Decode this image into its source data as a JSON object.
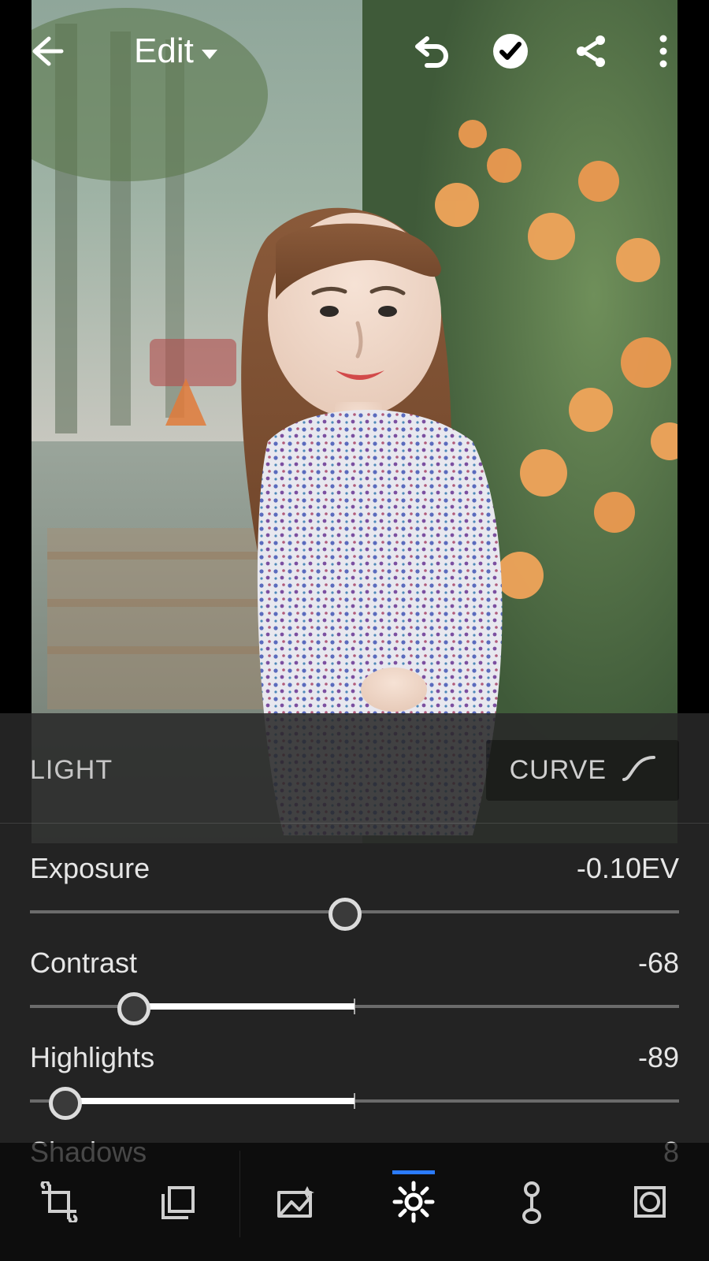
{
  "header": {
    "mode_label": "Edit"
  },
  "panel": {
    "title": "LIGHT",
    "curve_label": "CURVE"
  },
  "sliders": [
    {
      "label": "Exposure",
      "value_text": "-0.10EV",
      "thumb_pct": 48.5,
      "fill_from_pct": 48.5,
      "fill_to_pct": 50
    },
    {
      "label": "Contrast",
      "value_text": "-68",
      "thumb_pct": 16,
      "fill_from_pct": 16,
      "fill_to_pct": 50
    },
    {
      "label": "Highlights",
      "value_text": "-89",
      "thumb_pct": 5.5,
      "fill_from_pct": 5.5,
      "fill_to_pct": 50
    },
    {
      "label": "Shadows",
      "value_text": "8",
      "thumb_pct": 54,
      "fill_from_pct": 50,
      "fill_to_pct": 54
    }
  ],
  "bottom_tools": {
    "active": "light",
    "items": [
      "crop",
      "presets",
      "auto",
      "light",
      "color",
      "effects"
    ]
  }
}
